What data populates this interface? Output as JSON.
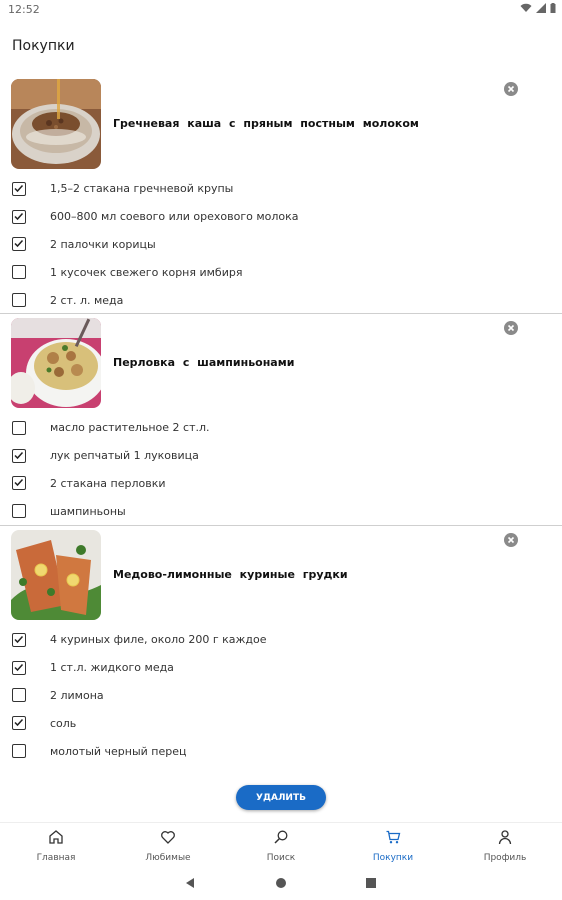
{
  "status": {
    "time": "12:52"
  },
  "page": {
    "title": "Покупки"
  },
  "recipes": [
    {
      "name": "Гречневая каша с пряным постным молоком",
      "ingredients": [
        {
          "text": "1,5–2 стакана гречневой крупы",
          "checked": true
        },
        {
          "text": "600–800 мл соевого или орехового молока",
          "checked": true
        },
        {
          "text": "2 палочки корицы",
          "checked": true
        },
        {
          "text": "1 кусочек свежего корня имбиря",
          "checked": false
        },
        {
          "text": "2 ст. л. меда",
          "checked": false
        }
      ]
    },
    {
      "name": "Перловка с шампиньонами",
      "ingredients": [
        {
          "text": "масло растительное 2 ст.л.",
          "checked": false
        },
        {
          "text": "лук репчатый 1 луковица",
          "checked": true
        },
        {
          "text": "2 стакана перловки",
          "checked": true
        },
        {
          "text": "шампиньоны",
          "checked": false
        }
      ]
    },
    {
      "name": "Медово-лимонные куриные грудки",
      "ingredients": [
        {
          "text": "4 куриных филе, около 200 г каждое",
          "checked": true
        },
        {
          "text": "1 ст.л. жидкого меда",
          "checked": true
        },
        {
          "text": "2 лимона",
          "checked": false
        },
        {
          "text": "соль",
          "checked": true
        },
        {
          "text": "молотый черный перец",
          "checked": false
        }
      ]
    }
  ],
  "actions": {
    "delete_label": "УДАЛИТЬ"
  },
  "nav": {
    "items": [
      {
        "label": "Главная",
        "icon": "home-icon",
        "active": false
      },
      {
        "label": "Любимые",
        "icon": "heart-icon",
        "active": false
      },
      {
        "label": "Поиск",
        "icon": "search-icon",
        "active": false
      },
      {
        "label": "Покупки",
        "icon": "cart-icon",
        "active": true
      },
      {
        "label": "Профиль",
        "icon": "person-icon",
        "active": false
      }
    ]
  },
  "colors": {
    "accent": "#1a6bc6",
    "checkbox": "#333333",
    "divider": "#cfcfcf"
  }
}
